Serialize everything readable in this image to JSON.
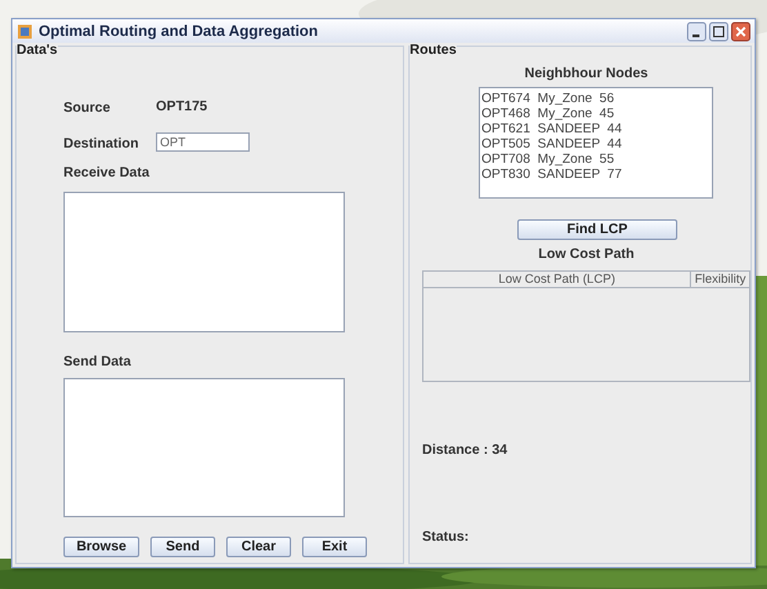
{
  "window": {
    "title": "Optimal Routing and Data Aggregation"
  },
  "data_panel": {
    "title": "Data's",
    "source_label": "Source",
    "source_value": "OPT175",
    "destination_label": "Destination",
    "destination_value": "OPT",
    "receive_label": "Receive Data",
    "send_label": "Send Data",
    "buttons": [
      "Browse",
      "Send",
      "Clear",
      "Exit"
    ]
  },
  "routes_panel": {
    "title": "Routes",
    "neighbour_title": "Neighbhour Nodes",
    "neighbours": [
      "OPT674  My_Zone  56",
      "OPT468  My_Zone  45",
      "OPT621  SANDEEP  44",
      "OPT505  SANDEEP  44",
      "OPT708  My_Zone  55",
      "OPT830  SANDEEP  77"
    ],
    "find_button": "Find LCP",
    "lcp_title": "Low Cost Path",
    "table": {
      "columns": [
        "Low Cost Path (LCP)",
        "Flexibility"
      ]
    },
    "distance": "Distance : 34",
    "status": "Status:"
  }
}
